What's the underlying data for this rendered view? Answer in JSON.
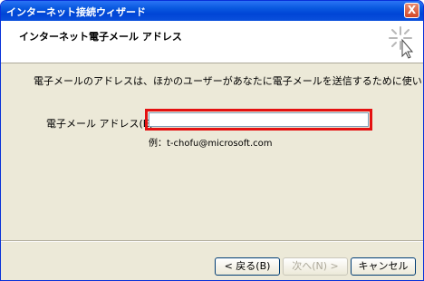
{
  "window": {
    "title": "インターネット接続ウィザード",
    "close_label": "X"
  },
  "header": {
    "title": "インターネット電子メール アドレス",
    "icon": "wizard-sparkle-icon"
  },
  "main": {
    "description": "電子メールのアドレスは、ほかのユーザーがあなたに電子メールを送信するために使います。",
    "email_label": "電子メール アドレス(E):",
    "email_value": "",
    "example": "例：t-chofu@microsoft.com"
  },
  "buttons": {
    "back": "< 戻る(B)",
    "next": "次へ(N) >",
    "cancel": "キャンセル"
  }
}
